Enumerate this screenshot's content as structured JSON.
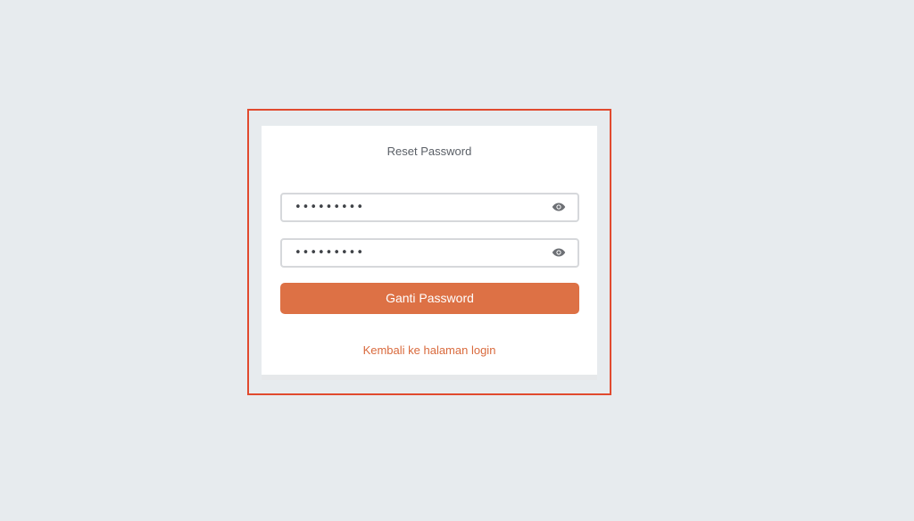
{
  "colors": {
    "page_background": "#e7ebee",
    "card_background": "#ffffff",
    "highlight_border": "#e14a2e",
    "primary_button": "#dd7145",
    "link": "#d96a3d"
  },
  "reset_form": {
    "title": "Reset Password",
    "new_password": {
      "value": "•••••••••",
      "toggle_icon": "eye-icon"
    },
    "confirm_password": {
      "value": "•••••••••",
      "toggle_icon": "eye-icon"
    },
    "submit_label": "Ganti Password",
    "back_link_label": "Kembali ke halaman login"
  }
}
